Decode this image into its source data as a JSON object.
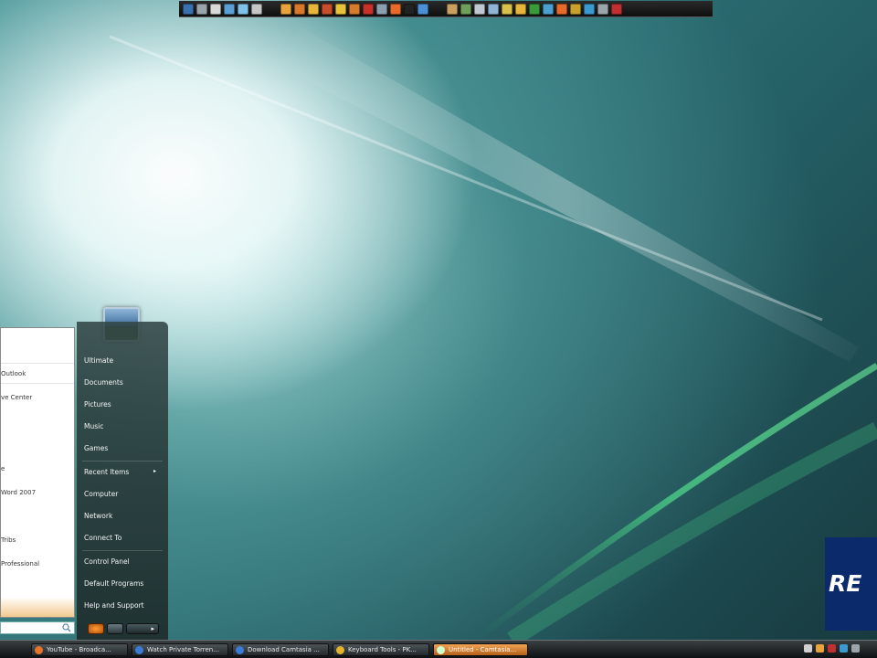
{
  "colors": {
    "desktop_glow": "#ffffff",
    "desktop_teal": "#2f7478",
    "start_accent": "#f4c98f",
    "taskbar_active": "#f3a452",
    "logo_blue": "#0b2a6b"
  },
  "toolbar": {
    "icons": [
      "monitor-icon",
      "printer-icon",
      "document-icon",
      "notepad-icon",
      "calculator-icon",
      "search-icon",
      "folder-icon",
      "folder-icon",
      "folder-icon",
      "folder-icon",
      "folder-icon",
      "folder-icon",
      "heart-icon",
      "gear-icon",
      "firefox-icon",
      "eightball-icon",
      "globe-icon",
      "image-icon",
      "tools-icon",
      "network-icon",
      "drive-icon",
      "bluetooth-icon",
      "folder-icon",
      "chrome-icon",
      "calc-icon",
      "firefox-icon",
      "winamp-icon",
      "msn-icon",
      "tools-icon",
      "close-icon"
    ]
  },
  "start_menu": {
    "programs": [
      "Outlook",
      "ve Center",
      "e",
      "Word 2007",
      "Tribs",
      "Professional"
    ],
    "right_items": [
      "Ultimate",
      "Documents",
      "Pictures",
      "Music",
      "Games",
      "Recent Items",
      "Computer",
      "Network",
      "Connect To",
      "Control Panel",
      "Default Programs",
      "Help and Support"
    ],
    "recent_items_arrow": "▸",
    "options_arrow": "▸"
  },
  "logo": {
    "text": "RE"
  },
  "taskbar": {
    "tasks": [
      {
        "label": "YouTube - Broadca...",
        "icon_color": "#e8742a"
      },
      {
        "label": "Watch Private Torren...",
        "icon_color": "#3a7bd5"
      },
      {
        "label": "Download Camtasia ...",
        "icon_color": "#3a7bd5"
      },
      {
        "label": "Keyboard Tools - PK...",
        "icon_color": "#e3b32a"
      },
      {
        "label": "Untitled - Camtasia...",
        "icon_color": "#d0ffd0"
      }
    ],
    "tray_icons": [
      "volume-icon",
      "network-icon",
      "security-icon",
      "speaker-icon",
      "clock-icon"
    ]
  }
}
